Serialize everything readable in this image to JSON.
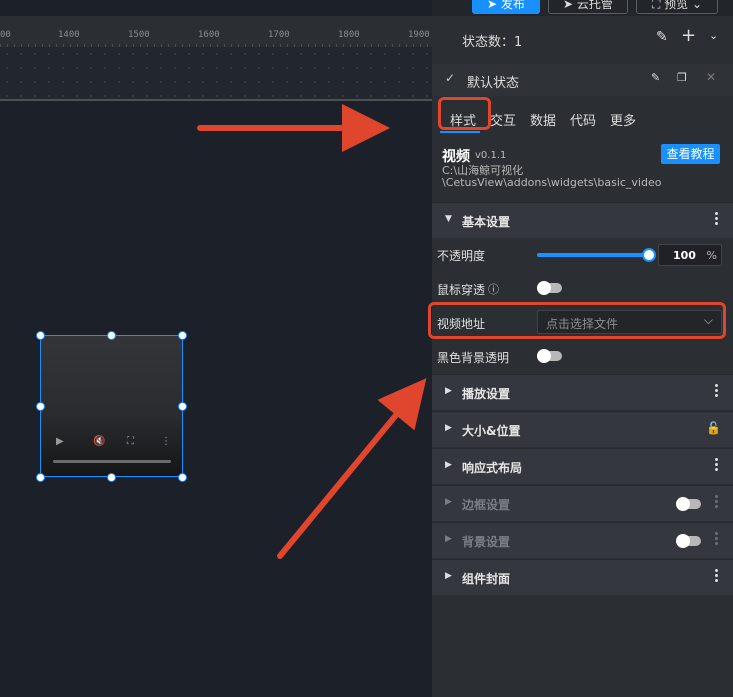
{
  "topbar": {
    "publish_label": "发布",
    "cloud_label": "云托管",
    "preview_label": "预览"
  },
  "ruler": {
    "ticks": [
      "00",
      "1400",
      "1500",
      "1600",
      "1700",
      "1800",
      "1900"
    ]
  },
  "panel": {
    "state_count_label": "状态数：1",
    "default_state_label": "默认状态",
    "tabs": [
      "样式",
      "交互",
      "数据",
      "代码",
      "更多"
    ],
    "widget": {
      "title": "视频",
      "version": "v0.1.1",
      "path_line1": "C:\\山海鲸可视化",
      "path_line2": "\\CetusView\\addons\\widgets\\basic_video",
      "tutorial_label": "查看教程"
    },
    "basic_section": "基本设置",
    "opacity_label": "不透明度",
    "opacity_value": "100",
    "opacity_unit": "%",
    "opacity_fraction": 1.0,
    "mouse_through_label": "鼠标穿透",
    "video_url_label": "视频地址",
    "video_url_placeholder": "点击选择文件",
    "black_bg_label": "黑色背景透明",
    "sections": [
      "播放设置",
      "大小&位置",
      "响应式布局",
      "边框设置",
      "背景设置",
      "组件封面"
    ]
  },
  "colors": {
    "accent": "#1890ff",
    "annotation": "#e0452e"
  }
}
